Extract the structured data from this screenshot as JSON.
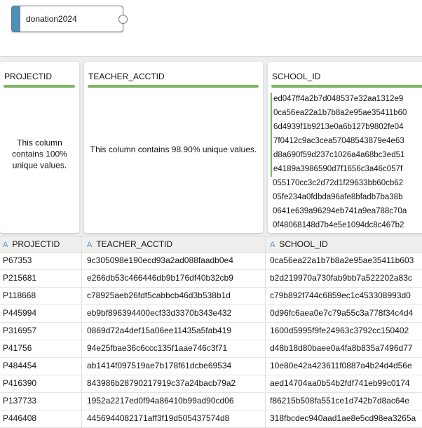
{
  "canvas": {
    "node_title": "donation2024"
  },
  "profile": {
    "cards": [
      {
        "header": "PROJECTID",
        "message": "This column contains 100% unique values."
      },
      {
        "header": "TEACHER_ACCTID",
        "message": "This column contains 98.90% unique values."
      },
      {
        "header": "SCHOOL_ID",
        "values": [
          "ed047ff4a2b7d048537e32aa1312e9",
          "0ca56ea22a1b7b8a2e95ae35411b60",
          "6d4939f1b9213e0a6b127b9802fe04",
          "7f0412c9ac3cea57048543879e4e63",
          "d8a690f59d237c1026a4a68bc3ed51",
          "e4189a3986590d7f1656c3a46c057f",
          "055170cc3c2d72d1f29633bb60cb62",
          "05fe234a0fdbda96afe8bfadb7ba38b",
          "0641e639a96294eb741a9ea788c70a",
          "0f48068148d7b4e5e1094dc8c467b2"
        ]
      }
    ]
  },
  "table": {
    "columns": [
      "PROJECTID",
      "TEACHER_ACCTID",
      "SCHOOL_ID"
    ],
    "type_icon": "A",
    "rows": [
      [
        "P67353",
        "9c305098e190ecd93a2ad088faadb0e4",
        "0ca56ea22a1b7b8a2e95ae35411b603"
      ],
      [
        "P215681",
        "e266db53c466446db9b176df40b32cb9",
        "b2d219970a730fab9bb7a522202a83c"
      ],
      [
        "P118668",
        "c78925aeb26fdf5cabbcb46d3b538b1d",
        "c79b892f744c6859ec1c453308993d0"
      ],
      [
        "P445994",
        "eb9bf896394400ecf33d3370b343e432",
        "0d96fc6aea0e7c79a55c3a778f34c4d4"
      ],
      [
        "P316957",
        "0869d72a4def15a06ee11435a5fab419",
        "1600d5995f9fe24963c3792cc150402"
      ],
      [
        "P41756",
        "94e25fbae36c6ccc135f1aae746c3f71",
        "d48b18d80baee0a4fa8b835a7496d77"
      ],
      [
        "P484454",
        "ab1414f097519ae7b178f61dcbe69534",
        "10e80e42a423611f0887a4b24d4d56e"
      ],
      [
        "P416390",
        "843986b28790217919c37a24bacb79a2",
        "aed14704aa0b54b2fdf741eb99c0174"
      ],
      [
        "P137733",
        "1952a2217ed0f94a86410b99ad90cd06",
        "f86215b508fa551ce1d742b7d8ac64e"
      ],
      [
        "P446408",
        "4456944082171aff3f19d505437574d8",
        "318fbcdec940aad1ae8e5cd98ea3265a"
      ]
    ]
  }
}
